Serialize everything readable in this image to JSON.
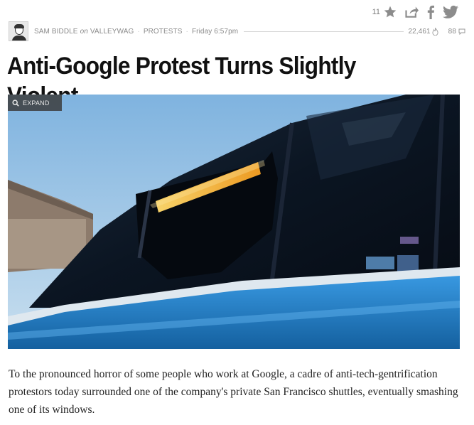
{
  "share": {
    "star_count": "11",
    "icons": [
      "star-icon",
      "share-icon",
      "facebook-icon",
      "twitter-icon"
    ]
  },
  "byline": {
    "author": "SAM BIDDLE",
    "on": "on",
    "blog": "VALLEYWAG",
    "tag": "PROTESTS",
    "time": "Friday 6:57pm",
    "views": "22,461",
    "comments": "88"
  },
  "article": {
    "title": "Anti-Google Protest Turns Slightly Violent",
    "expand_label": "EXPAND",
    "body": "To the pronounced horror of some people who work at Google, a cadre of anti-tech-gentrification protestors today surrounded one of the company's private San Francisco shuttles, eventually smashing one of its windows."
  },
  "colors": {
    "bus_blue": "#1f7fd0",
    "sky": "#9ec6e6",
    "window_dark": "#0d1a2a",
    "light_strip": "#f4b43a"
  }
}
